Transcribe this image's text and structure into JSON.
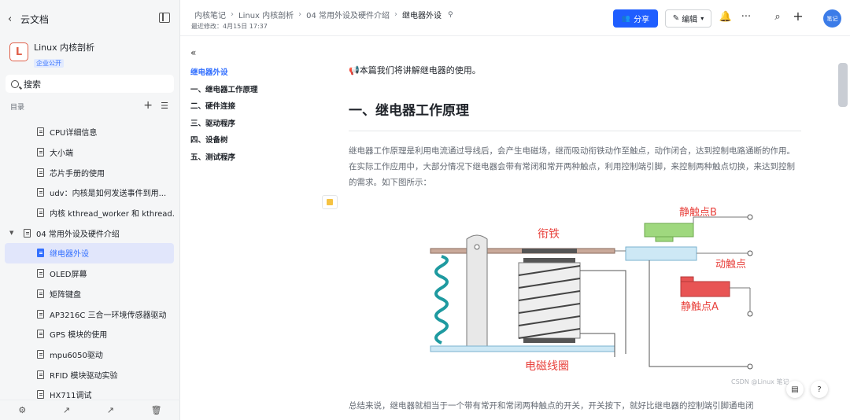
{
  "sidebar": {
    "back_label": "云文档",
    "kb_logo": "L",
    "kb_name": "Linux 内核剖析",
    "kb_badge": "企业公开",
    "search_placeholder": "搜索",
    "toc_label": "目录",
    "items": [
      {
        "label": "CPU详细信息",
        "level": 2
      },
      {
        "label": "大小端",
        "level": 2
      },
      {
        "label": "芯片手册的使用",
        "level": 2
      },
      {
        "label": "udv：内核是如何发送事件到用...",
        "level": 2
      },
      {
        "label": "内核 kthread_worker 和 kthread...",
        "level": 2
      },
      {
        "label": "04 常用外设及硬件介绍",
        "level": 1,
        "expanded": true
      },
      {
        "label": "继电器外设",
        "level": 2,
        "active": true
      },
      {
        "label": "OLED屏幕",
        "level": 2
      },
      {
        "label": "矩阵键盘",
        "level": 2
      },
      {
        "label": "AP3216C 三合一环境传感器驱动",
        "level": 2
      },
      {
        "label": "GPS 模块的使用",
        "level": 2
      },
      {
        "label": "mpu6050驱动",
        "level": 2
      },
      {
        "label": "RFID 模块驱动实验",
        "level": 2
      },
      {
        "label": "HX711调试",
        "level": 2
      }
    ],
    "bottom_icons": [
      "gear-icon",
      "share-out-icon",
      "chart-icon",
      "trash-icon"
    ]
  },
  "header": {
    "crumbs": [
      "内核笔记",
      "Linux 内核剖析",
      "04 常用外设及硬件介绍",
      "继电器外设"
    ],
    "modified": "最近修改：4月15日 17:37",
    "share_label": "分享",
    "edit_label": "编辑",
    "avatar_text": "笔记"
  },
  "outline": {
    "items": [
      {
        "label": "继电器外设",
        "current": true
      },
      {
        "label": "一、继电器工作原理"
      },
      {
        "label": "二、硬件连接"
      },
      {
        "label": "三、驱动程序"
      },
      {
        "label": "四、设备树"
      },
      {
        "label": "五、测试程序"
      }
    ]
  },
  "doc": {
    "intro": "📢本篇我们将讲解继电器的使用。",
    "heading": "一、继电器工作原理",
    "paragraph": "继电器工作原理是利用电流通过导线后，会产生电磁场，继而吸动衔铁动作至触点，动作闭合，达到控制电路通断的作用。在实际工作应用中，大部分情况下继电器会带有常闭和常开两种触点，利用控制端引脚，来控制两种触点切换，来达到控制的需求。如下图所示：",
    "paragraph2_line1": "总结来说，继电器就相当于一个带有常开和常闭两种触点的开关，开关按下，就好比继电器的控制端引脚通电闭",
    "figure": {
      "label_armature": "衔铁",
      "label_nc": "静触点B",
      "label_moving": "动触点",
      "label_no": "静触点A",
      "label_coil": "电磁线圈",
      "color_label": "#e8413c",
      "color_contact_b": "#9fd87e",
      "color_contact_a": "#e85454",
      "color_moving": "#cde8f5",
      "color_spring": "#1e9aa0"
    },
    "watermark": "CSDN @Linux 笔记"
  }
}
